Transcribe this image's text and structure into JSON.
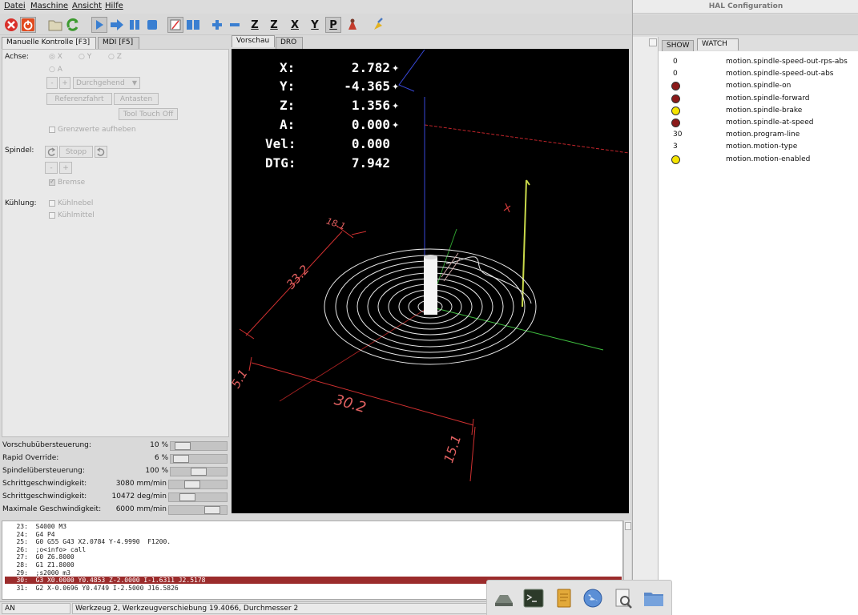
{
  "menu": [
    "Datei",
    "Maschine",
    "Ansicht",
    "Hilfe"
  ],
  "toolbar": {
    "icons": [
      "estop-icon",
      "power-icon",
      "open-file-icon",
      "reload-icon",
      "run-icon",
      "step-icon",
      "pause-icon",
      "stop-icon",
      "block-delete-icon",
      "optional-stop-icon",
      "zoom-in-icon",
      "zoom-out-icon",
      "view-z-icon",
      "view-z2-icon",
      "view-x-icon",
      "view-y-icon",
      "view-p-icon",
      "rotate-icon",
      "clear-icon"
    ],
    "view_labels": [
      "Z",
      "Z",
      "X",
      "Y",
      "P"
    ]
  },
  "left_tabs": [
    "Manuelle Kontrolle [F3]",
    "MDI [F5]"
  ],
  "preview_tabs": [
    "Vorschau",
    "DRO"
  ],
  "manual": {
    "axis_label": "Achse:",
    "axes": [
      "X",
      "Y",
      "Z",
      "A"
    ],
    "jog_mode": "Durchgehend",
    "minus": "-",
    "plus": "+",
    "home_button": "Referenzfahrt",
    "touch_button": "Antasten",
    "tool_touch_off": "Tool Touch Off",
    "override_limits": "Grenzwerte aufheben",
    "spindle_label": "Spindel:",
    "spindle_stop": "Stopp",
    "brake": "Bremse",
    "cooling_label": "Kühlung:",
    "mist": "Kühlnebel",
    "flood": "Kühlmittel"
  },
  "sliders": [
    {
      "label": "Vorschubübersteuerung:",
      "value": "10 %",
      "level": 0.1
    },
    {
      "label": "Rapid Override:",
      "value": "6 %",
      "level": 0.06
    },
    {
      "label": "Spindelübersteuerung:",
      "value": "100 %",
      "level": 0.5
    },
    {
      "label": "Schrittgeschwindigkeit:",
      "value": "3080 mm/min",
      "level": 0.37
    },
    {
      "label": "Schrittgeschwindigkeit:",
      "value": "10472 deg/min",
      "level": 0.25
    },
    {
      "label": "Maximale Geschwindigkeit:",
      "value": "6000 mm/min",
      "level": 0.85
    }
  ],
  "dro": [
    {
      "label": "X:",
      "value": "2.782"
    },
    {
      "label": "Y:",
      "value": "-4.365"
    },
    {
      "label": "Z:",
      "value": "1.356"
    },
    {
      "label": "A:",
      "value": "0.000"
    },
    {
      "label": "Vel:",
      "value": "0.000"
    },
    {
      "label": "DTG:",
      "value": "7.942"
    }
  ],
  "dimensions": [
    "18.1",
    "33.2",
    "5.1",
    "30.2",
    "15.1"
  ],
  "gcode": [
    "   23:  S4000 M3",
    "   24:  G4 P4",
    "   25:  G0 G55 G43 X2.0784 Y-4.9990  F1200.",
    "   26:  ;o<info> call",
    "   27:  G0 Z6.8000",
    "   28:  G1 Z1.8000",
    "   29:  ;s2000 m3",
    "   30:  G3 X0.0000 Y0.4853 Z-2.0000 I-1.6311 J2.5178",
    "   31:  G2 X-0.0696 Y0.4749 I-2.5000 J16.5826"
  ],
  "highlight_line": 7,
  "status": {
    "mode": "AN",
    "tool": "Werkzeug 2, Werkzeugverschiebung 19.4066, Durchmesser 2"
  },
  "hal": {
    "title": "HAL Configuration",
    "tabs": [
      "SHOW",
      "WATCH"
    ],
    "watch": [
      {
        "kind": "value",
        "value": "0",
        "name": "motion.spindle-speed-out-rps-abs"
      },
      {
        "kind": "value",
        "value": "0",
        "name": "motion.spindle-speed-out-abs"
      },
      {
        "kind": "led",
        "color": "#8b1a1a",
        "name": "motion.spindle-on"
      },
      {
        "kind": "led",
        "color": "#8b1a1a",
        "name": "motion.spindle-forward"
      },
      {
        "kind": "led",
        "color": "#f5e400",
        "name": "motion.spindle-brake"
      },
      {
        "kind": "led",
        "color": "#8b1a1a",
        "name": "motion.spindle-at-speed"
      },
      {
        "kind": "value",
        "value": "30",
        "name": "motion.program-line"
      },
      {
        "kind": "value",
        "value": "3",
        "name": "motion.motion-type"
      },
      {
        "kind": "led",
        "color": "#f5e400",
        "name": "motion.motion-enabled"
      }
    ]
  },
  "dock_icons": [
    "computer-icon",
    "terminal-icon",
    "notes-icon",
    "globe-icon",
    "document-viewer-icon",
    "folder-icon"
  ]
}
